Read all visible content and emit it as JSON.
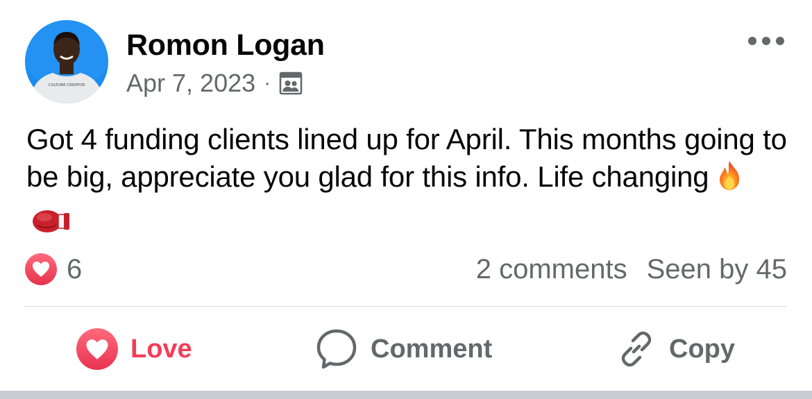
{
  "post": {
    "author": {
      "name": "Romon Logan",
      "avatar_icon": "profile-photo",
      "shirt_text": "CULTURE CREATOR"
    },
    "date": "Apr 7, 2023",
    "separator": "·",
    "audience_icon": "members-group-icon",
    "more_icon": "more-dots-icon",
    "text": "Got 4 funding clients lined up for April. This months going to be big, appreciate you glad for this info. Life changing",
    "emojis": [
      "fire-emoji",
      "boxing-glove-emoji"
    ]
  },
  "engagement": {
    "reaction_icon": "love-reaction-icon",
    "reaction_count": "6",
    "comments_label": "2 comments",
    "seen_by_label": "Seen by 45"
  },
  "actions": {
    "love_label": "Love",
    "comment_label": "Comment",
    "copy_label": "Copy"
  },
  "colors": {
    "love_accent": "#f33e58",
    "muted_text": "#65676b",
    "primary_text": "#050505",
    "avatar_bg": "#1d8cf0"
  }
}
